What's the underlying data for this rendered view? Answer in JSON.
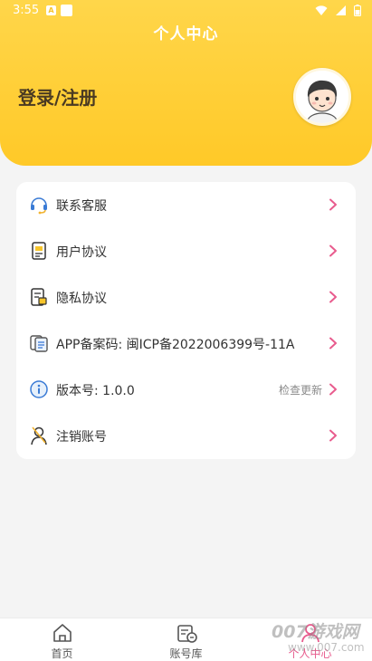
{
  "status_bar": {
    "time": "3:55",
    "notif_label": "A"
  },
  "header": {
    "title": "个人中心",
    "login_label": "登录/注册"
  },
  "menu": {
    "items": [
      {
        "label": "联系客服",
        "icon": "headset-icon"
      },
      {
        "label": "用户协议",
        "icon": "document-icon"
      },
      {
        "label": "隐私协议",
        "icon": "privacy-document-icon"
      },
      {
        "label": "APP备案码: 闽ICP备2022006399号-11A",
        "icon": "copy-document-icon"
      },
      {
        "label": "版本号: 1.0.0",
        "icon": "info-icon",
        "extra": "检查更新"
      },
      {
        "label": "注销账号",
        "icon": "user-cancel-icon"
      }
    ]
  },
  "tabbar": {
    "tabs": [
      {
        "label": "首页",
        "icon": "home-icon"
      },
      {
        "label": "账号库",
        "icon": "account-library-icon"
      },
      {
        "label": "个人中心",
        "icon": "profile-icon",
        "active": true
      }
    ]
  },
  "watermark": {
    "text": "007游戏网",
    "sub": "www.007.com"
  },
  "colors": {
    "accent": "#ffc928",
    "chevron": "#e85b8d",
    "text": "#333333"
  }
}
